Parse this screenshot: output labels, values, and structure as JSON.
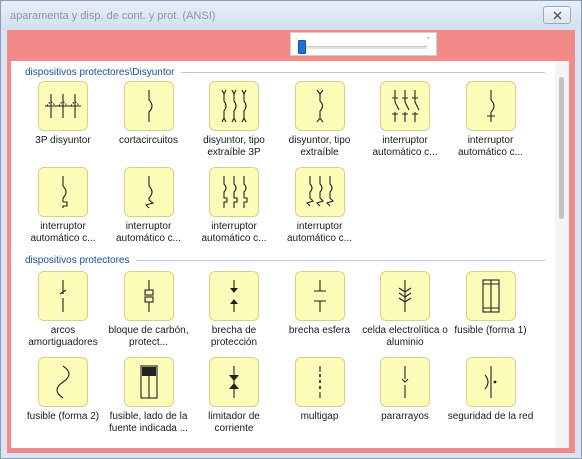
{
  "window": {
    "title": "aparamenta y disp. de cont. y prot. (ANSI)",
    "close_label": "✕"
  },
  "slider": {
    "value": 0,
    "tick_left": "-",
    "tick_right": "+"
  },
  "sections": [
    {
      "title": "dispositivos protectores\\Disyuntor",
      "items": [
        {
          "label": "3P disyuntor",
          "icon": "three-pole-breaker-icon"
        },
        {
          "label": "cortacircuitos",
          "icon": "circuit-breaker-icon"
        },
        {
          "label": "disyuntor, tipo extraíble 3P",
          "icon": "draw-out-3p-breaker-icon"
        },
        {
          "label": "disyuntor, tipo extraíble",
          "icon": "draw-out-breaker-icon"
        },
        {
          "label": "interruptor automático c...",
          "icon": "auto-switch-3p-icon"
        },
        {
          "label": "interruptor automático c...",
          "icon": "auto-switch-icon"
        },
        {
          "label": "interruptor automático c...",
          "icon": "auto-switch-thermal-icon"
        },
        {
          "label": "interruptor automático c...",
          "icon": "auto-switch-magnetic-icon"
        },
        {
          "label": "interruptor automático c...",
          "icon": "auto-switch-3p-thermal-icon"
        },
        {
          "label": "interruptor automático c...",
          "icon": "auto-switch-3p-magnetic-icon"
        }
      ]
    },
    {
      "title": "dispositivos protectores",
      "items": [
        {
          "label": "arcos amortiguadores",
          "icon": "arc-suppressor-icon"
        },
        {
          "label": "bloque de carbón, protect...",
          "icon": "carbon-block-icon"
        },
        {
          "label": "brecha de protección",
          "icon": "protective-gap-icon"
        },
        {
          "label": "brecha esfera",
          "icon": "sphere-gap-icon"
        },
        {
          "label": "celda electrolítica o aluminio",
          "icon": "electrolytic-cell-icon"
        },
        {
          "label": "fusible (forma 1)",
          "icon": "fuse-form1-icon"
        },
        {
          "label": "fusible (forma 2)",
          "icon": "fuse-form2-icon"
        },
        {
          "label": "fusible, lado de la fuente indicada ...",
          "icon": "fuse-source-side-icon"
        },
        {
          "label": "limitador de corriente",
          "icon": "current-limiter-icon"
        },
        {
          "label": "multigap",
          "icon": "multigap-icon"
        },
        {
          "label": "pararrayos",
          "icon": "lightning-arrester-icon"
        },
        {
          "label": "seguridad de la red",
          "icon": "network-protector-icon"
        }
      ]
    }
  ]
}
